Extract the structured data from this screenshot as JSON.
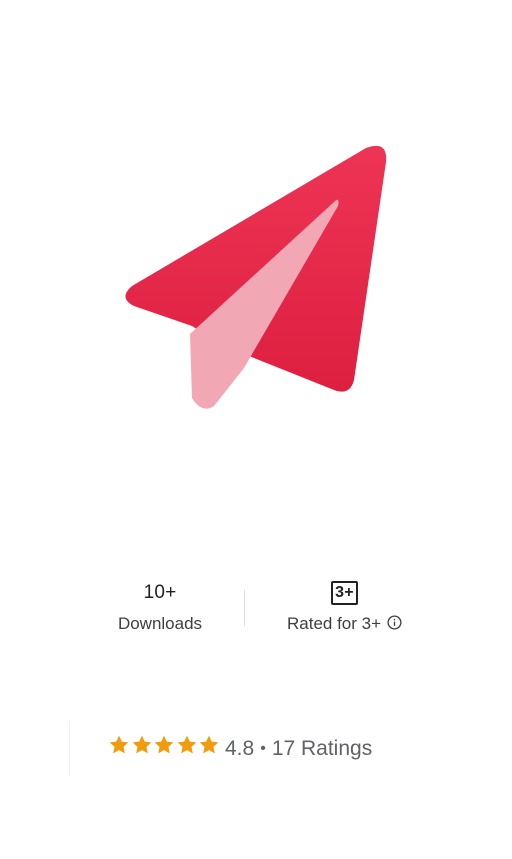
{
  "app": {
    "icon": "paper-plane-icon",
    "colors": {
      "icon_primary": "#e8274b",
      "icon_secondary": "#f2a7b4"
    }
  },
  "stats": {
    "downloads": {
      "value": "10+",
      "label": "Downloads"
    },
    "content_rating": {
      "badge": "3+",
      "label": "Rated for 3+",
      "info_icon": "info-icon"
    }
  },
  "rating": {
    "stars": 5,
    "star_icon": "star-icon",
    "star_color": "#f29b0d",
    "score": "4.8",
    "separator": "•",
    "count_text": "17 Ratings"
  }
}
